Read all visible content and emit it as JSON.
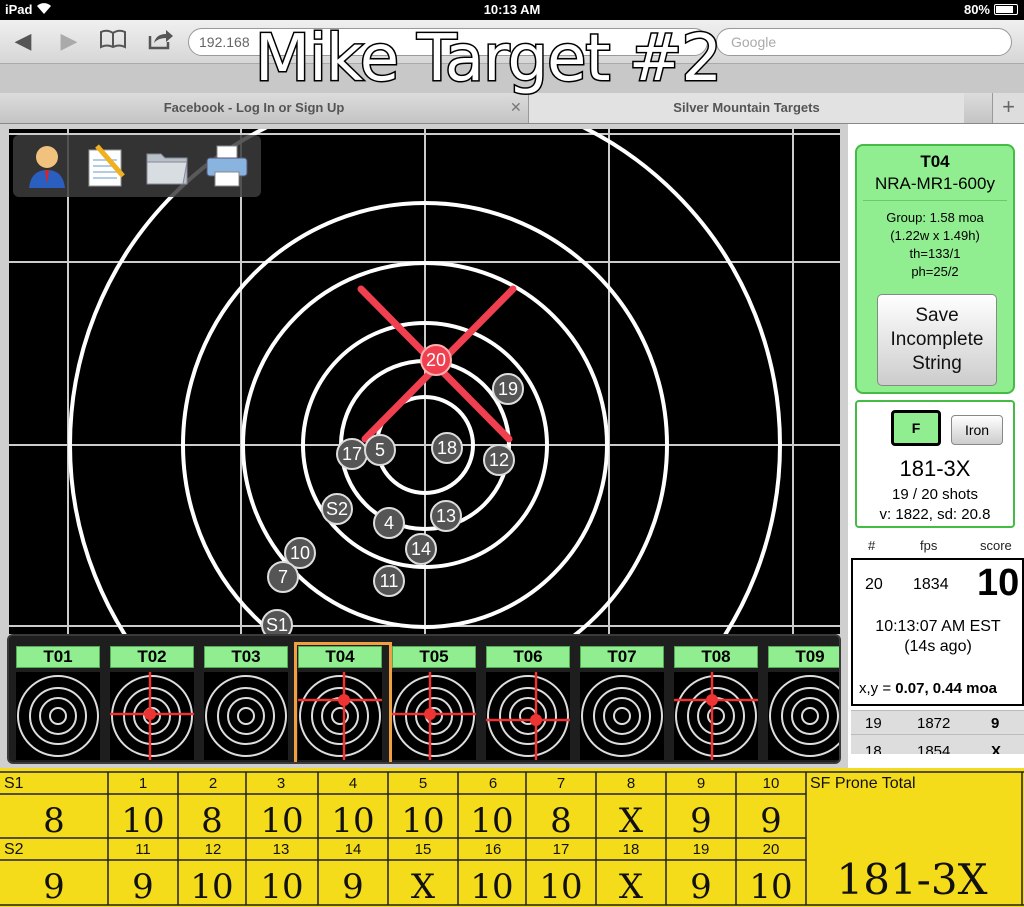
{
  "status": {
    "device": "iPad",
    "time": "10:13 AM",
    "battery": "80%"
  },
  "browser": {
    "url": "192.168",
    "search_placeholder": "Google",
    "overlay_title": "Mike Target #2",
    "tabs": [
      {
        "label": "Facebook - Log In or Sign Up"
      },
      {
        "label": "Silver Mountain Targets"
      }
    ]
  },
  "tools": [
    "user-icon",
    "notepad-icon",
    "folder-icon",
    "printer-icon"
  ],
  "target": {
    "shots": [
      {
        "label": "20",
        "highlight": true
      },
      {
        "label": "19"
      },
      {
        "label": "18"
      },
      {
        "label": "17"
      },
      {
        "label": "5"
      },
      {
        "label": "12"
      },
      {
        "label": "13"
      },
      {
        "label": "4"
      },
      {
        "label": "14"
      },
      {
        "label": "S2"
      },
      {
        "label": "10"
      },
      {
        "label": "7"
      },
      {
        "label": "11"
      },
      {
        "label": "S1"
      }
    ]
  },
  "thumbs": [
    {
      "label": "T01",
      "selected": false
    },
    {
      "label": "T02",
      "selected": false
    },
    {
      "label": "T03",
      "selected": false
    },
    {
      "label": "T04",
      "selected": true
    },
    {
      "label": "T05",
      "selected": false
    },
    {
      "label": "T06",
      "selected": false
    },
    {
      "label": "T07",
      "selected": false
    },
    {
      "label": "T08",
      "selected": false
    },
    {
      "label": "T09",
      "selected": false
    }
  ],
  "info": {
    "code": "T04",
    "course": "NRA-MR1-600y",
    "group": "Group: 1.58 moa",
    "dims": "(1.22w x 1.49h)",
    "th": "th=133/1",
    "ph": "ph=25/2",
    "save_label": "Save Incomplete String"
  },
  "score": {
    "f_label": "F",
    "iron_label": "Iron",
    "total": "181-3X",
    "shots": "19 / 20 shots",
    "velocity": "v: 1822, sd: 20.8"
  },
  "shot_table": {
    "headers": [
      "#",
      "fps",
      "score"
    ],
    "last": {
      "num": "20",
      "fps": "1834",
      "score": "10",
      "time": "10:13:07 AM EST",
      "ago": "(14s ago)",
      "xy_label": "x,y = ",
      "xy_value": "0.07, 0.44 moa"
    },
    "rows": [
      {
        "num": "19",
        "fps": "1872",
        "score": "9"
      },
      {
        "num": "18",
        "fps": "1854",
        "score": "X"
      }
    ]
  },
  "sheet": {
    "row1_label": "S1",
    "row2_label": "S2",
    "header_right": "SF Prone Total",
    "row1_numbers": [
      "1",
      "2",
      "3",
      "4",
      "5",
      "6",
      "7",
      "8",
      "9",
      "10"
    ],
    "row1_scores": [
      "8",
      "10",
      "8",
      "10",
      "10",
      "10",
      "10",
      "8",
      "X",
      "9",
      "9"
    ],
    "row2_numbers": [
      "11",
      "12",
      "13",
      "14",
      "15",
      "16",
      "17",
      "18",
      "19",
      "20"
    ],
    "row2_scores": [
      "9",
      "9",
      "10",
      "10",
      "9",
      "X",
      "10",
      "10",
      "X",
      "9",
      "10"
    ],
    "total": "181-3X"
  }
}
